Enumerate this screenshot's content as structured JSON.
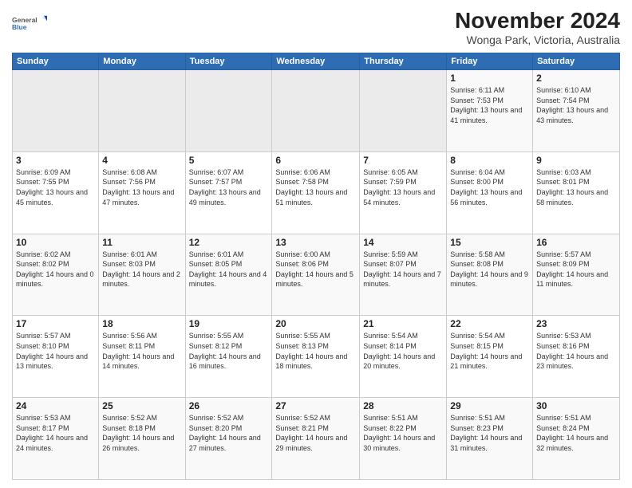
{
  "logo": {
    "line1": "General",
    "line2": "Blue"
  },
  "title": "November 2024",
  "subtitle": "Wonga Park, Victoria, Australia",
  "headers": [
    "Sunday",
    "Monday",
    "Tuesday",
    "Wednesday",
    "Thursday",
    "Friday",
    "Saturday"
  ],
  "weeks": [
    [
      {
        "day": "",
        "info": ""
      },
      {
        "day": "",
        "info": ""
      },
      {
        "day": "",
        "info": ""
      },
      {
        "day": "",
        "info": ""
      },
      {
        "day": "",
        "info": ""
      },
      {
        "day": "1",
        "info": "Sunrise: 6:11 AM\nSunset: 7:53 PM\nDaylight: 13 hours\nand 41 minutes."
      },
      {
        "day": "2",
        "info": "Sunrise: 6:10 AM\nSunset: 7:54 PM\nDaylight: 13 hours\nand 43 minutes."
      }
    ],
    [
      {
        "day": "3",
        "info": "Sunrise: 6:09 AM\nSunset: 7:55 PM\nDaylight: 13 hours\nand 45 minutes."
      },
      {
        "day": "4",
        "info": "Sunrise: 6:08 AM\nSunset: 7:56 PM\nDaylight: 13 hours\nand 47 minutes."
      },
      {
        "day": "5",
        "info": "Sunrise: 6:07 AM\nSunset: 7:57 PM\nDaylight: 13 hours\nand 49 minutes."
      },
      {
        "day": "6",
        "info": "Sunrise: 6:06 AM\nSunset: 7:58 PM\nDaylight: 13 hours\nand 51 minutes."
      },
      {
        "day": "7",
        "info": "Sunrise: 6:05 AM\nSunset: 7:59 PM\nDaylight: 13 hours\nand 54 minutes."
      },
      {
        "day": "8",
        "info": "Sunrise: 6:04 AM\nSunset: 8:00 PM\nDaylight: 13 hours\nand 56 minutes."
      },
      {
        "day": "9",
        "info": "Sunrise: 6:03 AM\nSunset: 8:01 PM\nDaylight: 13 hours\nand 58 minutes."
      }
    ],
    [
      {
        "day": "10",
        "info": "Sunrise: 6:02 AM\nSunset: 8:02 PM\nDaylight: 14 hours\nand 0 minutes."
      },
      {
        "day": "11",
        "info": "Sunrise: 6:01 AM\nSunset: 8:03 PM\nDaylight: 14 hours\nand 2 minutes."
      },
      {
        "day": "12",
        "info": "Sunrise: 6:01 AM\nSunset: 8:05 PM\nDaylight: 14 hours\nand 4 minutes."
      },
      {
        "day": "13",
        "info": "Sunrise: 6:00 AM\nSunset: 8:06 PM\nDaylight: 14 hours\nand 5 minutes."
      },
      {
        "day": "14",
        "info": "Sunrise: 5:59 AM\nSunset: 8:07 PM\nDaylight: 14 hours\nand 7 minutes."
      },
      {
        "day": "15",
        "info": "Sunrise: 5:58 AM\nSunset: 8:08 PM\nDaylight: 14 hours\nand 9 minutes."
      },
      {
        "day": "16",
        "info": "Sunrise: 5:57 AM\nSunset: 8:09 PM\nDaylight: 14 hours\nand 11 minutes."
      }
    ],
    [
      {
        "day": "17",
        "info": "Sunrise: 5:57 AM\nSunset: 8:10 PM\nDaylight: 14 hours\nand 13 minutes."
      },
      {
        "day": "18",
        "info": "Sunrise: 5:56 AM\nSunset: 8:11 PM\nDaylight: 14 hours\nand 14 minutes."
      },
      {
        "day": "19",
        "info": "Sunrise: 5:55 AM\nSunset: 8:12 PM\nDaylight: 14 hours\nand 16 minutes."
      },
      {
        "day": "20",
        "info": "Sunrise: 5:55 AM\nSunset: 8:13 PM\nDaylight: 14 hours\nand 18 minutes."
      },
      {
        "day": "21",
        "info": "Sunrise: 5:54 AM\nSunset: 8:14 PM\nDaylight: 14 hours\nand 20 minutes."
      },
      {
        "day": "22",
        "info": "Sunrise: 5:54 AM\nSunset: 8:15 PM\nDaylight: 14 hours\nand 21 minutes."
      },
      {
        "day": "23",
        "info": "Sunrise: 5:53 AM\nSunset: 8:16 PM\nDaylight: 14 hours\nand 23 minutes."
      }
    ],
    [
      {
        "day": "24",
        "info": "Sunrise: 5:53 AM\nSunset: 8:17 PM\nDaylight: 14 hours\nand 24 minutes."
      },
      {
        "day": "25",
        "info": "Sunrise: 5:52 AM\nSunset: 8:18 PM\nDaylight: 14 hours\nand 26 minutes."
      },
      {
        "day": "26",
        "info": "Sunrise: 5:52 AM\nSunset: 8:20 PM\nDaylight: 14 hours\nand 27 minutes."
      },
      {
        "day": "27",
        "info": "Sunrise: 5:52 AM\nSunset: 8:21 PM\nDaylight: 14 hours\nand 29 minutes."
      },
      {
        "day": "28",
        "info": "Sunrise: 5:51 AM\nSunset: 8:22 PM\nDaylight: 14 hours\nand 30 minutes."
      },
      {
        "day": "29",
        "info": "Sunrise: 5:51 AM\nSunset: 8:23 PM\nDaylight: 14 hours\nand 31 minutes."
      },
      {
        "day": "30",
        "info": "Sunrise: 5:51 AM\nSunset: 8:24 PM\nDaylight: 14 hours\nand 32 minutes."
      }
    ]
  ]
}
